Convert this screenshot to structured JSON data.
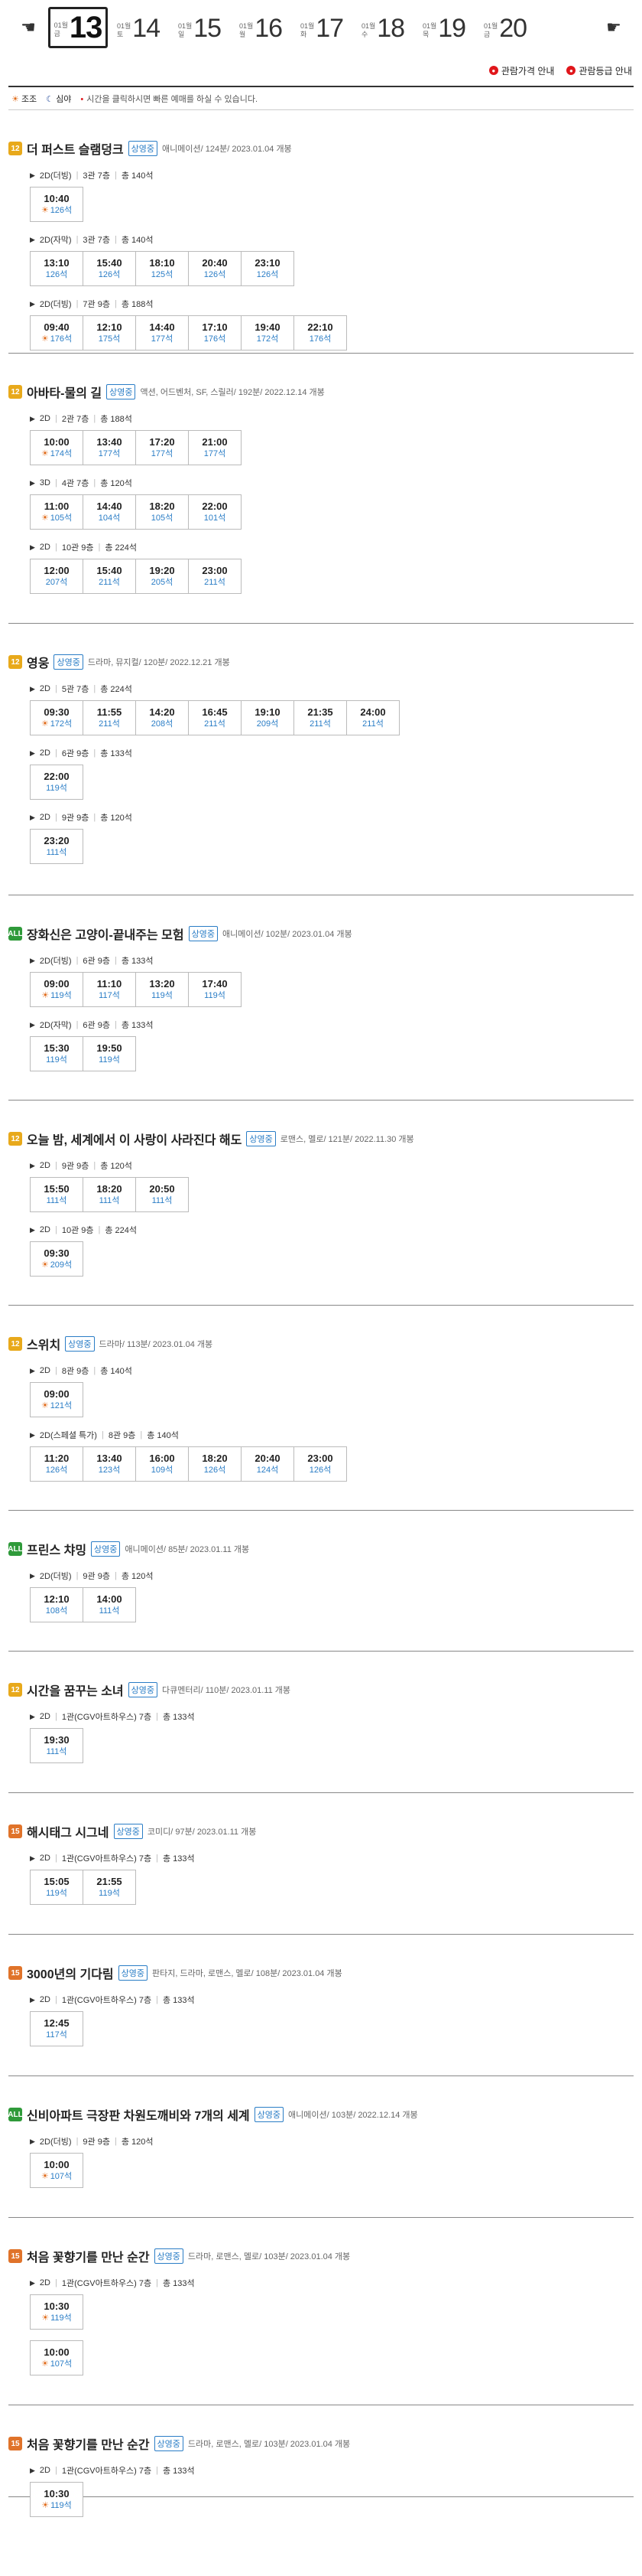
{
  "date_strip": {
    "prev_icon": "hand-left-icon",
    "next_icon": "hand-right-icon",
    "dates": [
      {
        "month": "01월",
        "weekday": "금",
        "day": "13",
        "selected": true
      },
      {
        "month": "01월",
        "weekday": "토",
        "day": "14"
      },
      {
        "month": "01월",
        "weekday": "일",
        "day": "15"
      },
      {
        "month": "01월",
        "weekday": "월",
        "day": "16"
      },
      {
        "month": "01월",
        "weekday": "화",
        "day": "17"
      },
      {
        "month": "01월",
        "weekday": "수",
        "day": "18"
      },
      {
        "month": "01월",
        "weekday": "목",
        "day": "19"
      },
      {
        "month": "01월",
        "weekday": "금",
        "day": "20"
      }
    ]
  },
  "info_links": {
    "price": "관람가격 안내",
    "rating": "관람등급 안내"
  },
  "legend": {
    "morning": "조조",
    "night": "심야",
    "note": "시간을 클릭하시면 빠른 예매를 하실 수 있습니다."
  },
  "movies": [
    {
      "rating": "12",
      "title": "더 퍼스트 슬램덩크",
      "status": "상영중",
      "meta": "애니메이션/ 124분/ 2023.01.04 개봉",
      "halls": [
        {
          "format": "2D(더빙)",
          "hall": "3관 7층",
          "seats": "총 140석",
          "slots": [
            {
              "time": "10:40",
              "seats": "126석",
              "morning": true
            }
          ]
        },
        {
          "format": "2D(자막)",
          "hall": "3관 7층",
          "seats": "총 140석",
          "slots": [
            {
              "time": "13:10",
              "seats": "126석"
            },
            {
              "time": "15:40",
              "seats": "126석"
            },
            {
              "time": "18:10",
              "seats": "125석"
            },
            {
              "time": "20:40",
              "seats": "126석"
            },
            {
              "time": "23:10",
              "seats": "126석"
            }
          ]
        },
        {
          "format": "2D(더빙)",
          "hall": "7관 9층",
          "seats": "총 188석",
          "slots": [
            {
              "time": "09:40",
              "seats": "176석",
              "morning": true
            },
            {
              "time": "12:10",
              "seats": "175석"
            },
            {
              "time": "14:40",
              "seats": "177석"
            },
            {
              "time": "17:10",
              "seats": "176석"
            },
            {
              "time": "19:40",
              "seats": "172석"
            },
            {
              "time": "22:10",
              "seats": "176석"
            }
          ]
        }
      ]
    },
    {
      "rating": "12",
      "title": "아바타-물의 길",
      "status": "상영중",
      "meta": "액션, 어드벤처, SF, 스릴러/ 192분/ 2022.12.14 개봉",
      "halls": [
        {
          "format": "2D",
          "hall": "2관 7층",
          "seats": "총 188석",
          "slots": [
            {
              "time": "10:00",
              "seats": "174석",
              "morning": true
            },
            {
              "time": "13:40",
              "seats": "177석"
            },
            {
              "time": "17:20",
              "seats": "177석"
            },
            {
              "time": "21:00",
              "seats": "177석"
            }
          ]
        },
        {
          "format": "3D",
          "hall": "4관 7층",
          "seats": "총 120석",
          "slots": [
            {
              "time": "11:00",
              "seats": "105석",
              "morning": true
            },
            {
              "time": "14:40",
              "seats": "104석"
            },
            {
              "time": "18:20",
              "seats": "105석"
            },
            {
              "time": "22:00",
              "seats": "101석"
            }
          ]
        },
        {
          "format": "2D",
          "hall": "10관 9층",
          "seats": "총 224석",
          "slots": [
            {
              "time": "12:00",
              "seats": "207석"
            },
            {
              "time": "15:40",
              "seats": "211석"
            },
            {
              "time": "19:20",
              "seats": "205석"
            },
            {
              "time": "23:00",
              "seats": "211석"
            }
          ]
        }
      ]
    },
    {
      "rating": "12",
      "title": "영웅",
      "status": "상영중",
      "meta": "드라마, 뮤지컬/ 120분/ 2022.12.21 개봉",
      "halls": [
        {
          "format": "2D",
          "hall": "5관 7층",
          "seats": "총 224석",
          "slots": [
            {
              "time": "09:30",
              "seats": "172석",
              "morning": true
            },
            {
              "time": "11:55",
              "seats": "211석"
            },
            {
              "time": "14:20",
              "seats": "208석"
            },
            {
              "time": "16:45",
              "seats": "211석"
            },
            {
              "time": "19:10",
              "seats": "209석"
            },
            {
              "time": "21:35",
              "seats": "211석"
            },
            {
              "time": "24:00",
              "seats": "211석"
            }
          ]
        },
        {
          "format": "2D",
          "hall": "6관 9층",
          "seats": "총 133석",
          "slots": [
            {
              "time": "22:00",
              "seats": "119석"
            }
          ]
        },
        {
          "format": "2D",
          "hall": "9관 9층",
          "seats": "총 120석",
          "slots": [
            {
              "time": "23:20",
              "seats": "111석"
            }
          ]
        }
      ]
    },
    {
      "rating": "ALL",
      "title": "장화신은 고양이-끝내주는 모험",
      "status": "상영중",
      "meta": "애니메이션/ 102분/ 2023.01.04 개봉",
      "halls": [
        {
          "format": "2D(더빙)",
          "hall": "6관 9층",
          "seats": "총 133석",
          "slots": [
            {
              "time": "09:00",
              "seats": "119석",
              "morning": true
            },
            {
              "time": "11:10",
              "seats": "117석"
            },
            {
              "time": "13:20",
              "seats": "119석"
            },
            {
              "time": "17:40",
              "seats": "119석"
            }
          ]
        },
        {
          "format": "2D(자막)",
          "hall": "6관 9층",
          "seats": "총 133석",
          "slots": [
            {
              "time": "15:30",
              "seats": "119석"
            },
            {
              "time": "19:50",
              "seats": "119석"
            }
          ]
        }
      ]
    },
    {
      "rating": "12",
      "title": "오늘 밤, 세계에서 이 사랑이 사라진다 해도",
      "status": "상영중",
      "meta": "로맨스, 멜로/ 121분/ 2022.11.30 개봉",
      "halls": [
        {
          "format": "2D",
          "hall": "9관 9층",
          "seats": "총 120석",
          "slots": [
            {
              "time": "15:50",
              "seats": "111석"
            },
            {
              "time": "18:20",
              "seats": "111석"
            },
            {
              "time": "20:50",
              "seats": "111석"
            }
          ]
        },
        {
          "format": "2D",
          "hall": "10관 9층",
          "seats": "총 224석",
          "slots": [
            {
              "time": "09:30",
              "seats": "209석",
              "morning": true
            }
          ]
        }
      ]
    },
    {
      "rating": "12",
      "title": "스위치",
      "status": "상영중",
      "meta": "드라마/ 113분/ 2023.01.04 개봉",
      "halls": [
        {
          "format": "2D",
          "hall": "8관 9층",
          "seats": "총 140석",
          "slots": [
            {
              "time": "09:00",
              "seats": "121석",
              "morning": true
            }
          ]
        },
        {
          "format": "2D(스페셜 특가)",
          "hall": "8관 9층",
          "seats": "총 140석",
          "slots": [
            {
              "time": "11:20",
              "seats": "126석"
            },
            {
              "time": "13:40",
              "seats": "123석"
            },
            {
              "time": "16:00",
              "seats": "109석"
            },
            {
              "time": "18:20",
              "seats": "126석"
            },
            {
              "time": "20:40",
              "seats": "124석"
            },
            {
              "time": "23:00",
              "seats": "126석"
            }
          ]
        }
      ]
    },
    {
      "rating": "ALL",
      "title": "프린스 챠밍",
      "status": "상영중",
      "meta": "애니메이션/ 85분/ 2023.01.11 개봉",
      "halls": [
        {
          "format": "2D(더빙)",
          "hall": "9관 9층",
          "seats": "총 120석",
          "slots": [
            {
              "time": "12:10",
              "seats": "108석"
            },
            {
              "time": "14:00",
              "seats": "111석"
            }
          ]
        }
      ]
    },
    {
      "rating": "12",
      "title": "시간을 꿈꾸는 소녀",
      "status": "상영중",
      "meta": "다큐멘터리/ 110분/ 2023.01.11 개봉",
      "halls": [
        {
          "format": "2D",
          "hall": "1관(CGV아트하우스) 7층",
          "seats": "총 133석",
          "slots": [
            {
              "time": "19:30",
              "seats": "111석"
            }
          ]
        }
      ]
    },
    {
      "rating": "15",
      "title": "해시태그 시그네",
      "status": "상영중",
      "meta": "코미디/ 97분/ 2023.01.11 개봉",
      "halls": [
        {
          "format": "2D",
          "hall": "1관(CGV아트하우스) 7층",
          "seats": "총 133석",
          "slots": [
            {
              "time": "15:05",
              "seats": "119석"
            },
            {
              "time": "21:55",
              "seats": "119석"
            }
          ]
        }
      ]
    },
    {
      "rating": "15",
      "title": "3000년의 기다림",
      "status": "상영중",
      "meta": "판타지, 드라마, 로맨스, 멜로/ 108분/ 2023.01.04 개봉",
      "halls": [
        {
          "format": "2D",
          "hall": "1관(CGV아트하우스) 7층",
          "seats": "총 133석",
          "slots": [
            {
              "time": "12:45",
              "seats": "117석"
            }
          ]
        }
      ]
    },
    {
      "rating": "ALL",
      "title": "신비아파트 극장판 차원도깨비와 7개의 세계",
      "status": "상영중",
      "meta": "애니메이션/ 103분/ 2022.12.14 개봉",
      "halls": [
        {
          "format": "2D(더빙)",
          "hall": "9관 9층",
          "seats": "총 120석",
          "slots": [
            {
              "time": "10:00",
              "seats": "107석",
              "morning": true
            }
          ]
        }
      ]
    },
    {
      "rating": "15",
      "title": "처음 꽃향기를 만난 순간",
      "status": "상영중",
      "meta": "드라마, 로맨스, 멜로/ 103분/ 2023.01.04 개봉",
      "halls": [
        {
          "format": "2D",
          "hall": "1관(CGV아트하우스) 7층",
          "seats": "총 133석",
          "slots": [
            {
              "time": "10:30",
              "seats": "119석",
              "morning": true
            }
          ]
        },
        {
          "format": "",
          "hall": "",
          "seats": "",
          "slots": [
            {
              "time": "10:00",
              "seats": "107석",
              "morning": true
            }
          ]
        }
      ]
    },
    {
      "rating": "15",
      "title": "처음 꽃향기를 만난 순간",
      "status": "상영중",
      "meta": "드라마, 로맨스, 멜로/ 103분/ 2023.01.04 개봉",
      "halls": [
        {
          "format": "2D",
          "hall": "1관(CGV아트하우스) 7층",
          "seats": "총 133석",
          "slots": [
            {
              "time": "10:30",
              "seats": "119석",
              "morning": true
            }
          ]
        }
      ]
    }
  ]
}
